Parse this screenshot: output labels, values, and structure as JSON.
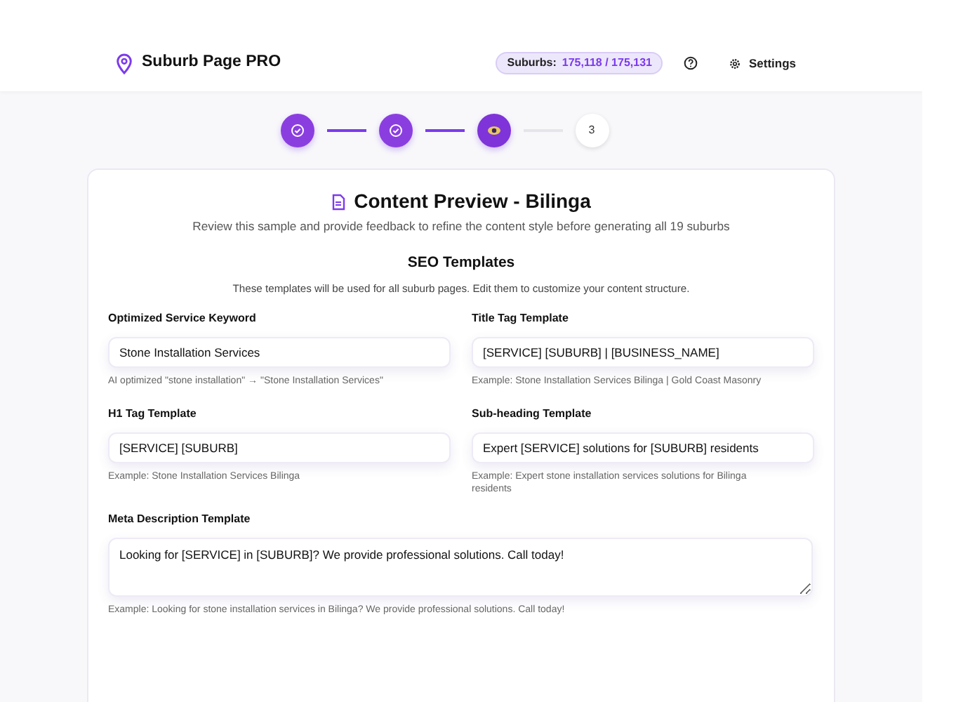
{
  "header": {
    "app_name": "Suburb Page PRO",
    "suburbs_label": "Suburbs:",
    "suburbs_count": "175,118 / 175,131",
    "settings_label": "Settings"
  },
  "steps": [
    {
      "kind": "done"
    },
    {
      "kind": "done"
    },
    {
      "kind": "current"
    },
    {
      "kind": "pending",
      "label": "3"
    }
  ],
  "preview": {
    "title": "Content Preview - Bilinga",
    "subtitle": "Review this sample and provide feedback to refine the content style before generating all 19 suburbs",
    "section_title": "SEO Templates",
    "section_subtitle": "These templates will be used for all suburb pages. Edit them to customize your content structure.",
    "fields": [
      {
        "kind": "input",
        "label": "Optimized Service Keyword",
        "value": "Stone Installation Services",
        "hint": "AI optimized \"stone installation\" → \"Stone Installation Services\""
      },
      {
        "kind": "input",
        "label": "Title Tag Template",
        "value": "[SERVICE] [SUBURB] | [BUSINESS_NAME]",
        "hint": "Example: Stone Installation Services Bilinga | Gold Coast Masonry"
      },
      {
        "kind": "input",
        "label": "H1 Tag Template",
        "value": "[SERVICE] [SUBURB]",
        "hint": "Example: Stone Installation Services Bilinga"
      },
      {
        "kind": "input",
        "label": "Sub-heading Template",
        "value": "Expert [SERVICE] solutions for [SUBURB] residents",
        "hint": "Example: Expert stone installation services solutions for Bilinga residents"
      },
      {
        "kind": "textarea",
        "label": "Meta Description Template",
        "value": "Looking for [SERVICE] in [SUBURB]? We provide professional solutions. Call today!",
        "hint": "Example: Looking for stone installation services in Bilinga? We provide professional solutions. Call today!"
      }
    ]
  }
}
